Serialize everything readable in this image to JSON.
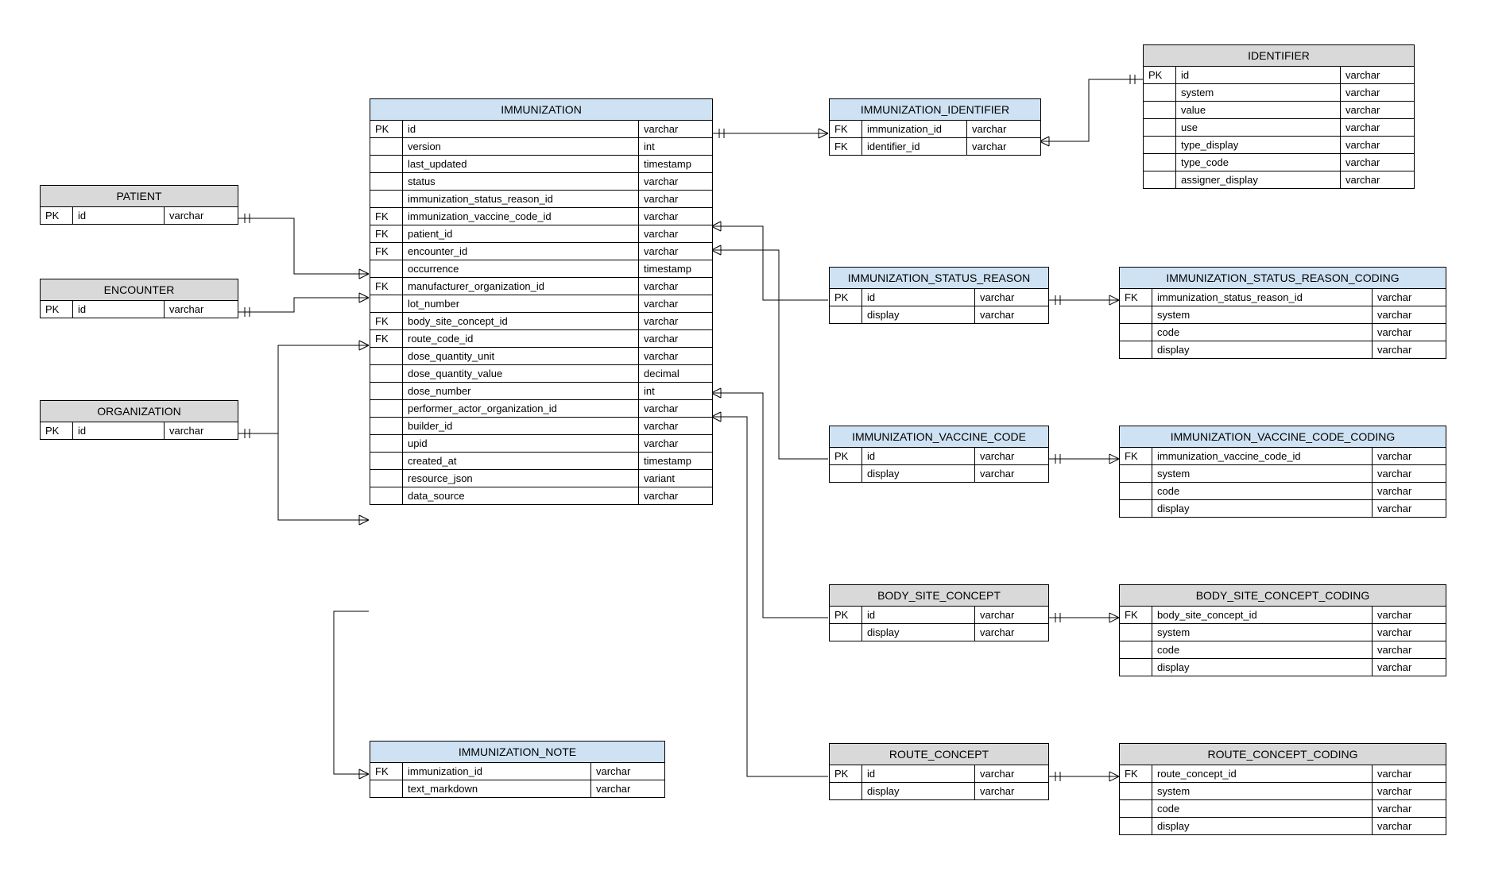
{
  "entities": {
    "patient": {
      "title": "PATIENT",
      "rows": [
        {
          "k": "PK",
          "n": "id",
          "t": "varchar"
        }
      ]
    },
    "encounter": {
      "title": "ENCOUNTER",
      "rows": [
        {
          "k": "PK",
          "n": "id",
          "t": "varchar"
        }
      ]
    },
    "organization": {
      "title": "ORGANIZATION",
      "rows": [
        {
          "k": "PK",
          "n": "id",
          "t": "varchar"
        }
      ]
    },
    "immunization": {
      "title": "IMMUNIZATION",
      "rows": [
        {
          "k": "PK",
          "n": "id",
          "t": "varchar"
        },
        {
          "k": "",
          "n": "version",
          "t": "int"
        },
        {
          "k": "",
          "n": "last_updated",
          "t": "timestamp"
        },
        {
          "k": "",
          "n": "status",
          "t": "varchar"
        },
        {
          "k": "",
          "n": "immunization_status_reason_id",
          "t": "varchar"
        },
        {
          "k": "FK",
          "n": "immunization_vaccine_code_id",
          "t": "varchar"
        },
        {
          "k": "FK",
          "n": "patient_id",
          "t": "varchar"
        },
        {
          "k": "FK",
          "n": "encounter_id",
          "t": "varchar"
        },
        {
          "k": "",
          "n": "occurrence",
          "t": "timestamp"
        },
        {
          "k": "FK",
          "n": "manufacturer_organization_id",
          "t": "varchar"
        },
        {
          "k": "",
          "n": "lot_number",
          "t": "varchar"
        },
        {
          "k": "FK",
          "n": "body_site_concept_id",
          "t": "varchar"
        },
        {
          "k": "FK",
          "n": "route_code_id",
          "t": "varchar"
        },
        {
          "k": "",
          "n": "dose_quantity_unit",
          "t": "varchar"
        },
        {
          "k": "",
          "n": "dose_quantity_value",
          "t": "decimal"
        },
        {
          "k": "",
          "n": "dose_number",
          "t": "int"
        },
        {
          "k": "",
          "n": "performer_actor_organization_id",
          "t": "varchar"
        },
        {
          "k": "",
          "n": "builder_id",
          "t": "varchar"
        },
        {
          "k": "",
          "n": "upid",
          "t": "varchar"
        },
        {
          "k": "",
          "n": "created_at",
          "t": "timestamp"
        },
        {
          "k": "",
          "n": "resource_json",
          "t": "variant"
        },
        {
          "k": "",
          "n": "data_source",
          "t": "varchar"
        }
      ]
    },
    "immunization_note": {
      "title": "IMMUNIZATION_NOTE",
      "rows": [
        {
          "k": "FK",
          "n": "immunization_id",
          "t": "varchar"
        },
        {
          "k": "",
          "n": "text_markdown",
          "t": "varchar"
        }
      ]
    },
    "immunization_identifier": {
      "title": "IMMUNIZATION_IDENTIFIER",
      "rows": [
        {
          "k": "FK",
          "n": "immunization_id",
          "t": "varchar"
        },
        {
          "k": "FK",
          "n": "identifier_id",
          "t": "varchar"
        }
      ]
    },
    "identifier": {
      "title": "IDENTIFIER",
      "rows": [
        {
          "k": "PK",
          "n": "id",
          "t": "varchar"
        },
        {
          "k": "",
          "n": "system",
          "t": "varchar"
        },
        {
          "k": "",
          "n": "value",
          "t": "varchar"
        },
        {
          "k": "",
          "n": "use",
          "t": "varchar"
        },
        {
          "k": "",
          "n": "type_display",
          "t": "varchar"
        },
        {
          "k": "",
          "n": "type_code",
          "t": "varchar"
        },
        {
          "k": "",
          "n": "assigner_display",
          "t": "varchar"
        }
      ]
    },
    "immunization_status_reason": {
      "title": "IMMUNIZATION_STATUS_REASON",
      "rows": [
        {
          "k": "PK",
          "n": "id",
          "t": "varchar"
        },
        {
          "k": "",
          "n": "display",
          "t": "varchar"
        }
      ]
    },
    "immunization_status_reason_coding": {
      "title": "IMMUNIZATION_STATUS_REASON_CODING",
      "rows": [
        {
          "k": "FK",
          "n": "immunization_status_reason_id",
          "t": "varchar"
        },
        {
          "k": "",
          "n": "system",
          "t": "varchar"
        },
        {
          "k": "",
          "n": "code",
          "t": "varchar"
        },
        {
          "k": "",
          "n": "display",
          "t": "varchar"
        }
      ]
    },
    "immunization_vaccine_code": {
      "title": "IMMUNIZATION_VACCINE_CODE",
      "rows": [
        {
          "k": "PK",
          "n": "id",
          "t": "varchar"
        },
        {
          "k": "",
          "n": "display",
          "t": "varchar"
        }
      ]
    },
    "immunization_vaccine_code_coding": {
      "title": "IMMUNIZATION_VACCINE_CODE_CODING",
      "rows": [
        {
          "k": "FK",
          "n": "immunization_vaccine_code_id",
          "t": "varchar"
        },
        {
          "k": "",
          "n": "system",
          "t": "varchar"
        },
        {
          "k": "",
          "n": "code",
          "t": "varchar"
        },
        {
          "k": "",
          "n": "display",
          "t": "varchar"
        }
      ]
    },
    "body_site_concept": {
      "title": "BODY_SITE_CONCEPT",
      "rows": [
        {
          "k": "PK",
          "n": "id",
          "t": "varchar"
        },
        {
          "k": "",
          "n": "display",
          "t": "varchar"
        }
      ]
    },
    "body_site_concept_coding": {
      "title": "BODY_SITE_CONCEPT_CODING",
      "rows": [
        {
          "k": "FK",
          "n": "body_site_concept_id",
          "t": "varchar"
        },
        {
          "k": "",
          "n": "system",
          "t": "varchar"
        },
        {
          "k": "",
          "n": "code",
          "t": "varchar"
        },
        {
          "k": "",
          "n": "display",
          "t": "varchar"
        }
      ]
    },
    "route_concept": {
      "title": "ROUTE_CONCEPT",
      "rows": [
        {
          "k": "PK",
          "n": "id",
          "t": "varchar"
        },
        {
          "k": "",
          "n": "display",
          "t": "varchar"
        }
      ]
    },
    "route_concept_coding": {
      "title": "ROUTE_CONCEPT_CODING",
      "rows": [
        {
          "k": "FK",
          "n": "route_concept_id",
          "t": "varchar"
        },
        {
          "k": "",
          "n": "system",
          "t": "varchar"
        },
        {
          "k": "",
          "n": "code",
          "t": "varchar"
        },
        {
          "k": "",
          "n": "display",
          "t": "varchar"
        }
      ]
    }
  }
}
